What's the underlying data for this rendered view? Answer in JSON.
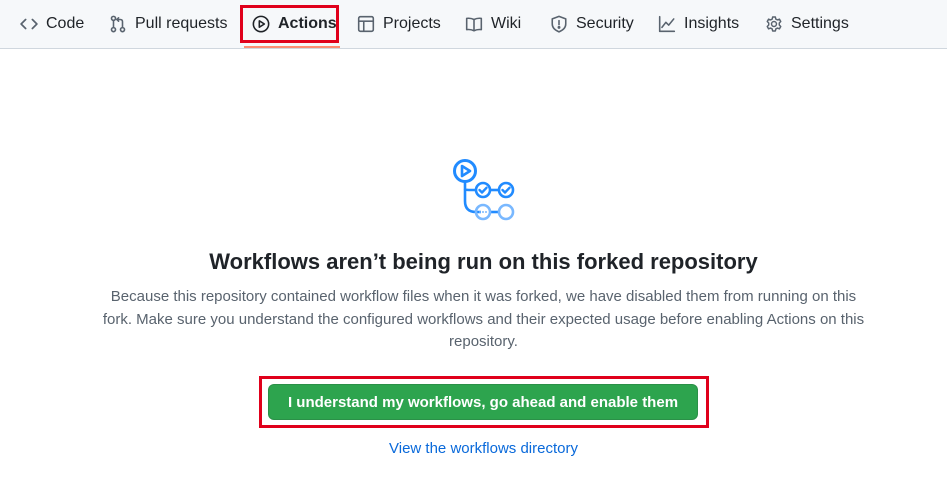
{
  "nav": {
    "tabs": [
      {
        "label": "Code",
        "icon": "code-icon"
      },
      {
        "label": "Pull requests",
        "icon": "git-pull-request-icon"
      },
      {
        "label": "Actions",
        "icon": "play-icon",
        "active": true
      },
      {
        "label": "Projects",
        "icon": "table-icon"
      },
      {
        "label": "Wiki",
        "icon": "book-icon"
      },
      {
        "label": "Security",
        "icon": "shield-icon"
      },
      {
        "label": "Insights",
        "icon": "graph-icon"
      },
      {
        "label": "Settings",
        "icon": "gear-icon"
      }
    ]
  },
  "main": {
    "hero_icon": "workflow-icon",
    "headline": "Workflows aren’t being run on this forked repository",
    "description": "Because this repository contained workflow files when it was forked, we have disabled them from running on this fork. Make sure you understand the configured workflows and their expected usage before enabling Actions on this repository.",
    "enable_button_label": "I understand my workflows, go ahead and enable them",
    "workflows_link_label": "View the workflows directory"
  },
  "colors": {
    "accent_green": "#2da44e",
    "link_blue": "#0969da",
    "highlight_red": "#e0001b",
    "active_underline": "#fd8c73"
  }
}
